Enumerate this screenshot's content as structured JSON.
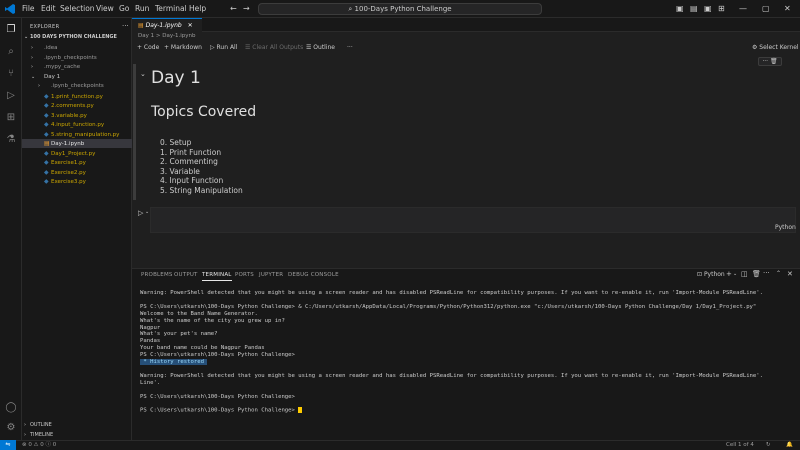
{
  "menu": [
    "File",
    "Edit",
    "Selection",
    "View",
    "Go",
    "Run",
    "Terminal",
    "Help"
  ],
  "search": {
    "text": "100-Days Python Challenge"
  },
  "sidebar": {
    "title": "EXPLORER",
    "root": "100 DAYS PYTHON CHALLENGE",
    "items": [
      {
        "label": ".idea",
        "depth": 1,
        "kind": "folder",
        "color": "#9d9d9d"
      },
      {
        "label": ".ipynb_checkpoints",
        "depth": 1,
        "kind": "folder",
        "color": "#9d9d9d"
      },
      {
        "label": ".mypy_cache",
        "depth": 1,
        "kind": "folder",
        "color": "#9d9d9d"
      },
      {
        "label": "Day 1",
        "depth": 1,
        "kind": "folder-open",
        "color": "#cccccc"
      },
      {
        "label": ".ipynb_checkpoints",
        "depth": 2,
        "kind": "folder",
        "color": "#9d9d9d"
      },
      {
        "label": "1.print_function.py",
        "depth": 2,
        "kind": "py",
        "color": "#cca700"
      },
      {
        "label": "2.comments.py",
        "depth": 2,
        "kind": "py",
        "color": "#cca700"
      },
      {
        "label": "3.variable.py",
        "depth": 2,
        "kind": "py",
        "color": "#cca700"
      },
      {
        "label": "4.input_function.py",
        "depth": 2,
        "kind": "py",
        "color": "#cca700"
      },
      {
        "label": "5.string_manipulation.py",
        "depth": 2,
        "kind": "py",
        "color": "#cca700"
      },
      {
        "label": "Day-1.ipynb",
        "depth": 2,
        "kind": "nb",
        "color": "#e7e7e7"
      },
      {
        "label": "Day1_Project.py",
        "depth": 2,
        "kind": "py",
        "color": "#cca700"
      },
      {
        "label": "Exercise1.py",
        "depth": 2,
        "kind": "py",
        "color": "#cca700"
      },
      {
        "label": "Exercise2.py",
        "depth": 2,
        "kind": "py",
        "color": "#cca700"
      },
      {
        "label": "Exercise3.py",
        "depth": 2,
        "kind": "py",
        "color": "#cca700"
      }
    ],
    "outline": "OUTLINE",
    "timeline": "TIMELINE"
  },
  "tab": {
    "label": "Day-1.ipynb"
  },
  "breadcrumb": "Day 1 > Day-1.ipynb",
  "toolbar": {
    "code": "+ Code",
    "markdown": "+ Markdown",
    "run_all": "Run All",
    "clear_outputs": "Clear All Outputs",
    "outline": "Outline",
    "select_kernel": "Select Kernel"
  },
  "notebook": {
    "h1": "Day 1",
    "h2": "Topics Covered",
    "topics": [
      "0. Setup",
      "1. Print Function",
      "2. Commenting",
      "3. Variable",
      "4. Input Function",
      "5. String Manipulation"
    ],
    "cell_language": "Python"
  },
  "panel": {
    "tabs": [
      "PROBLEMS",
      "OUTPUT",
      "TERMINAL",
      "PORTS",
      "JUPYTER",
      "DEBUG CONSOLE"
    ],
    "active_tab": "TERMINAL",
    "shell": "Python",
    "lines": [
      "Warning: PowerShell detected that you might be using a screen reader and has disabled PSReadLine for compatibility purposes. If you want to re-enable it, run 'Import-Module PSReadLine'.",
      "",
      "PS C:\\Users\\utkarsh\\100-Days Python Challenge> & C:/Users/utkarsh/AppData/Local/Programs/Python/Python312/python.exe \"c:/Users/utkarsh/100-Days Python Challenge/Day 1/Day1_Project.py\"",
      "Welcome to the Band Name Generator.",
      "What's the name of the city you grew up in?",
      "Nagpur",
      "What's your pet's name?",
      "Pandas",
      "Your band name could be Nagpur Pandas",
      "PS C:\\Users\\utkarsh\\100-Days Python Challenge>"
    ],
    "history": " * History restored ",
    "lines2": [
      "",
      "Warning: PowerShell detected that you might be using a screen reader and has disabled PSReadLine for compatibility purposes. If you want to re-enable it, run 'Import-Module PSReadLine'.",
      "Line'.",
      "",
      "PS C:\\Users\\utkarsh\\100-Days Python Challenge>"
    ],
    "prompt": "PS C:\\Users\\utkarsh\\100-Days Python Challenge> "
  },
  "status": {
    "errors": "0",
    "warnings": "0",
    "info": "0",
    "cell": "Cell 1 of 4"
  }
}
